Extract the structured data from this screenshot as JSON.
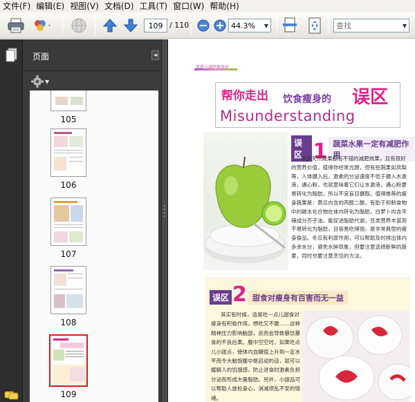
{
  "menubar": {
    "items": [
      "文件(F)",
      "编辑(E)",
      "视图(V)",
      "文档(D)",
      "工具(T)",
      "窗口(W)",
      "帮助(H)"
    ]
  },
  "toolbar": {
    "current_page": "109",
    "total_pages": "/ 110",
    "zoom": "44.3%",
    "search_placeholder": "查找"
  },
  "panel": {
    "title": "页面"
  },
  "thumbnails": [
    {
      "label": "105"
    },
    {
      "label": "106"
    },
    {
      "label": "107"
    },
    {
      "label": "108"
    },
    {
      "label": "109",
      "selected": true
    }
  ],
  "document": {
    "header_tag": "莱蔬汁減肥瘦身经",
    "title_part1": "帮你走出",
    "title_part2": "饮食瘦身的",
    "title_part3": "误区",
    "title_en": "Misunderstanding",
    "section1": {
      "label": "误区",
      "number": "1",
      "heading": "蔬菜水果一定有减肥作用",
      "body": "很多天然蔬果都有不错的减肥效果，且有很好的营养价值，值得你经常光顾，但有些蔬果如凤梨等，人体摄入后，激素的分泌速度不低于摄入水激液，遇心粉，也就意味着它们让水激液，遇心粉更易转化为脂肪，所以不宜盲目摄取。值得推荐的瘦身蔬果是：黄瓜内含的丙醇二酸，有助于抑制食物中的碳水化合物在体内转化为脂肪，白萝卜内含辛辣成分芥子油，能促进脂肪代谢，豆类营养丰富而不易转化为脂肪，且容易吃得饱，是非常典型的瘦身食品。冬瓜有利尿作用，可以帮助及时排出体内多余水分，避免水肿现象，但要注意选择新鲜的蔬果，同时也要注意烹饪的方法。"
    },
    "section2": {
      "label": "误区",
      "number": "2",
      "heading": "甜食对瘦身有百害而无一益",
      "body": "其实有时候，适度吃一点儿甜食对瘦身有积极作用，想吃又不敢……这种精神压力影响脑部，反而会导致暴饮暴食的不良后果。腹中空空时，如果吃点儿小甜点，使体内血糖值上升到一定水平而令大脑饱腹中枢启动的话，就可以缓解人的饥饿感，防止进食时激素负担分泌而形成大量脂肪。另外，小甜品可以帮助人放松身心，消减烦乱不安的情绪。"
    }
  },
  "colors": {
    "accent_pink": "#e0218a",
    "accent_purple": "#6a3d8f",
    "selection_red": "#d41b1b"
  }
}
